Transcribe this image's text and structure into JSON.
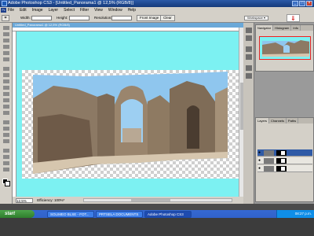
{
  "window": {
    "title": "Adobe Photoshop CS3 - [Untitled_Panorama1 @ 12,5% (RGB/8)]",
    "app_badge": "Ps"
  },
  "menu": [
    "File",
    "Edit",
    "Image",
    "Layer",
    "Select",
    "Filter",
    "View",
    "Window",
    "Help"
  ],
  "options": {
    "width_label": "Width:",
    "height_label": "Height:",
    "resolution_label": "Resolution:",
    "front_image_label": "Front Image",
    "clear_label": "Clear",
    "workspace_label": "Workspace ▾"
  },
  "document": {
    "tab_title": "Untitled_Panorama1 @ 12,5% (RGB/8)",
    "zoom": "12,5%",
    "status_text": "Efficiency: 100%*"
  },
  "panels": {
    "navigator_tabs": [
      "Navigator",
      "Histogram",
      "Info"
    ],
    "layers_tabs": [
      "Layers",
      "Channels",
      "Paths"
    ]
  },
  "taskbar": {
    "start": "start",
    "tasks": [
      "SOLIMEO BLSE - FOT...",
      "PRTSELA DOCUMENTS",
      "Adobe Photoshop CS3"
    ],
    "clock": "08:27 p.m."
  },
  "colors": {
    "canvas_bg": "#7cf1f2",
    "accent": "#2b5aa8"
  }
}
